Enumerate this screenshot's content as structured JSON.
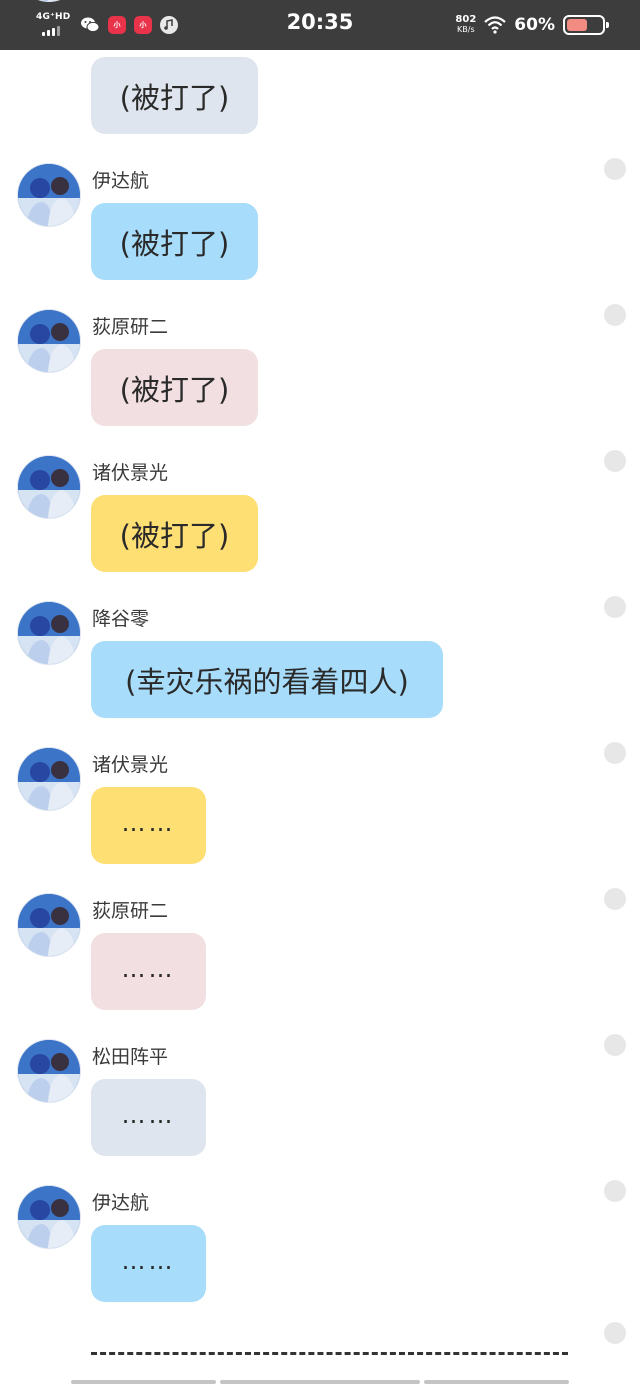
{
  "status_bar": {
    "network": "4G⁺HD",
    "time": "20:35",
    "speed_value": "802",
    "speed_unit": "KB/s",
    "battery_percent": "60%",
    "battery_level": 0.6,
    "icons": [
      "signal-icon",
      "wechat-icon",
      "app-icon",
      "app-icon",
      "music-icon",
      "wifi-icon",
      "battery-icon"
    ]
  },
  "colors": {
    "gray": "#dfe5ee",
    "blue": "#a7dcfa",
    "pink": "#f2dfe1",
    "yellow": "#fedf74"
  },
  "messages": [
    {
      "name": "",
      "text": "(被打了)",
      "color": "gray"
    },
    {
      "name": "伊达航",
      "text": "(被打了)",
      "color": "blue"
    },
    {
      "name": "荻原研二",
      "text": "(被打了)",
      "color": "pink"
    },
    {
      "name": "诸伏景光",
      "text": "(被打了)",
      "color": "yellow"
    },
    {
      "name": "降谷零",
      "text": "(幸灾乐祸的看着四人)",
      "color": "blue"
    },
    {
      "name": "诸伏景光",
      "text": "……",
      "color": "yellow"
    },
    {
      "name": "荻原研二",
      "text": "……",
      "color": "pink"
    },
    {
      "name": "松田阵平",
      "text": "……",
      "color": "gray"
    },
    {
      "name": "伊达航",
      "text": "……",
      "color": "blue"
    }
  ]
}
